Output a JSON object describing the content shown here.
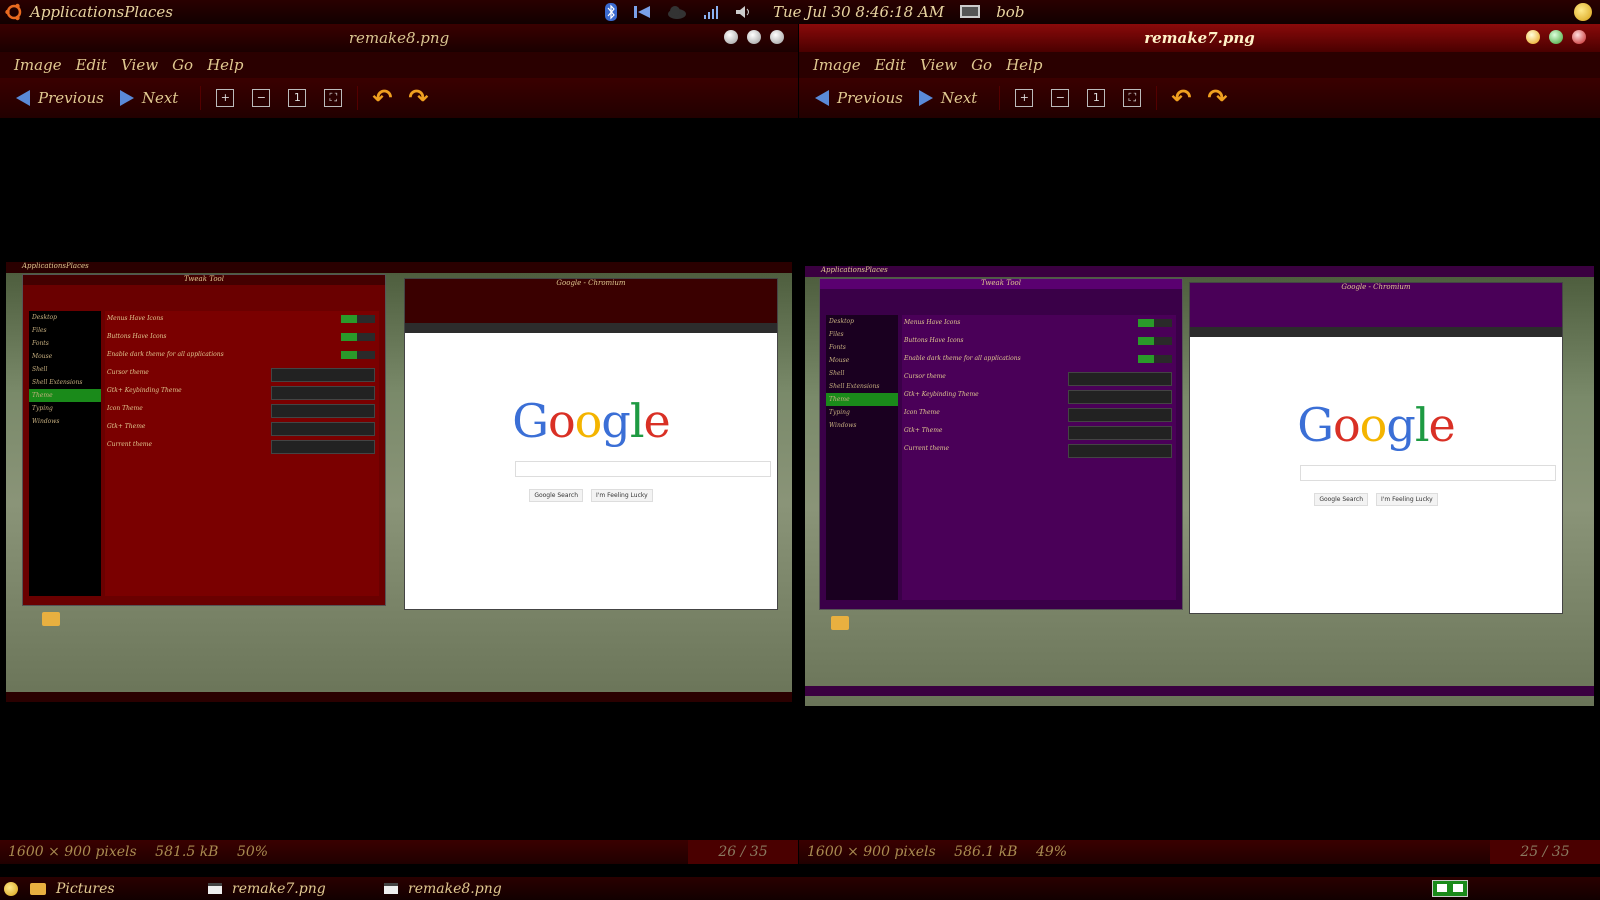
{
  "top_panel": {
    "menu_label": "ApplicationsPlaces",
    "clock": "Tue Jul 30   8:46:18 AM",
    "user": "bob"
  },
  "windows": [
    {
      "title": "remake8.png",
      "menu": [
        "Image",
        "Edit",
        "View",
        "Go",
        "Help"
      ],
      "toolbar": {
        "previous": "Previous",
        "next": "Next"
      },
      "status": {
        "dimensions": "1600 × 900 pixels",
        "size": "581.5 kB",
        "zoom": "50%",
        "counter": "26 / 35"
      }
    },
    {
      "title": "remake7.png",
      "menu": [
        "Image",
        "Edit",
        "View",
        "Go",
        "Help"
      ],
      "toolbar": {
        "previous": "Previous",
        "next": "Next"
      },
      "status": {
        "dimensions": "1600 × 900 pixels",
        "size": "586.1 kB",
        "zoom": "49%",
        "counter": "25 / 35"
      }
    }
  ],
  "screenshot_content": {
    "top_label": "ApplicationsPlaces",
    "tweak_title": "Tweak Tool",
    "sidebar": [
      "Desktop",
      "Files",
      "Fonts",
      "Mouse",
      "Shell",
      "Shell Extensions",
      "Theme",
      "Typing",
      "Windows"
    ],
    "sidebar_selected": "Theme",
    "rows": [
      "Menus Have Icons",
      "Buttons Have Icons",
      "Enable dark theme for all applications",
      "Cursor theme",
      "Gtk+ Keybinding Theme",
      "Icon Theme",
      "Gtk+ Theme",
      "Current theme"
    ],
    "browser_title": "Google - Chromium",
    "google_buttons": [
      "Google Search",
      "I'm Feeling Lucky"
    ]
  },
  "bottom_panel": {
    "places": "Pictures",
    "tasks": [
      "remake7.png",
      "remake8.png"
    ]
  },
  "colors": {
    "panel": "#2a0000",
    "accent_left": "#7a0000",
    "accent_right": "#4a0058",
    "text": "#e0c890"
  }
}
